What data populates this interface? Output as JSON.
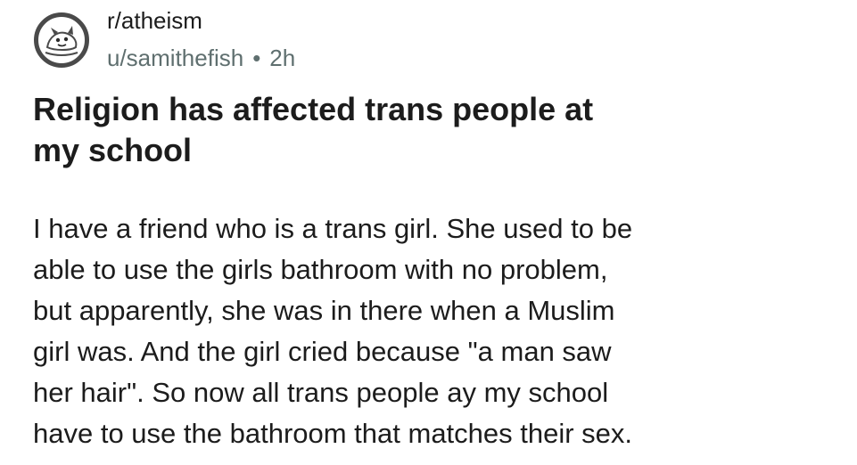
{
  "post": {
    "subreddit": "r/atheism",
    "author": "u/samithefish",
    "separator": "•",
    "time_ago": "2h",
    "avatar_icon": "subreddit-avatar-icon",
    "title_lines": [
      "Religion has affected trans people at",
      "my school"
    ],
    "body_lines": [
      "I have a friend who is a trans girl. She used to be",
      "able to use the girls bathroom with no problem,",
      "but apparently, she was in there when a Muslim",
      "girl was. And the girl cried because \"a man saw",
      "her hair\". So now all trans people ay my school",
      "have to use the bathroom that matches their sex."
    ]
  }
}
